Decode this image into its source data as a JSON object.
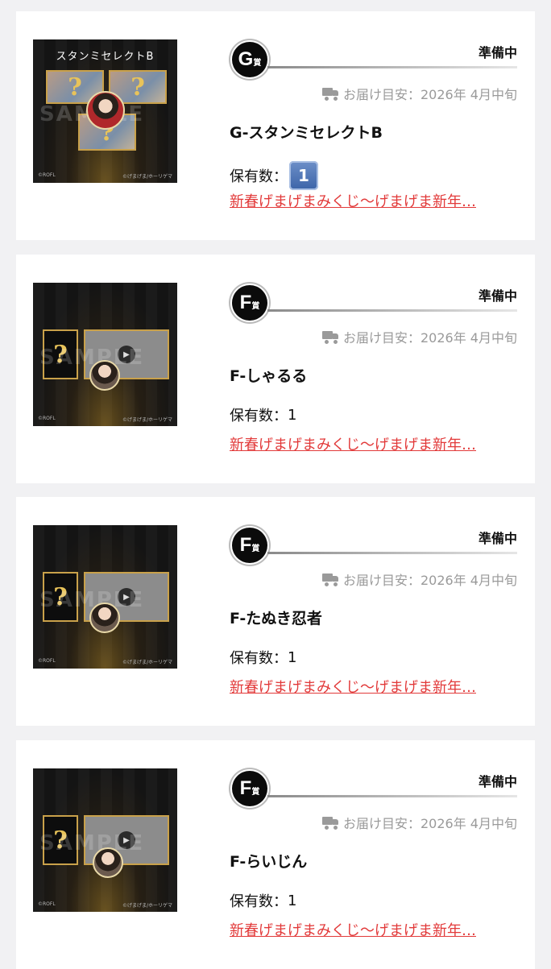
{
  "items": [
    {
      "thumb_title": "スタンミセレクトB",
      "thumb_variant": "g",
      "grade_letter": "G",
      "grade_suffix": "賞",
      "status": "準備中",
      "delivery": "お届け目安：2026年 4月中旬",
      "name": "G-スタンミセレクトB",
      "count_label": "保有数：",
      "count": "1",
      "count_style": "keycap-emoji",
      "lottery_link": "新春げまげまみくじ〜げまげま新年…"
    },
    {
      "thumb_title": "",
      "thumb_variant": "f",
      "grade_letter": "F",
      "grade_suffix": "賞",
      "status": "準備中",
      "delivery": "お届け目安：2026年 4月中旬",
      "name": "F-しゃるる",
      "count_label": "保有数：",
      "count": "1",
      "count_style": "plain",
      "lottery_link": "新春げまげまみくじ〜げまげま新年…"
    },
    {
      "thumb_title": "",
      "thumb_variant": "f",
      "grade_letter": "F",
      "grade_suffix": "賞",
      "status": "準備中",
      "delivery": "お届け目安：2026年 4月中旬",
      "name": "F-たぬき忍者",
      "count_label": "保有数：",
      "count": "1",
      "count_style": "plain",
      "lottery_link": "新春げまげまみくじ〜げまげま新年…"
    },
    {
      "thumb_title": "",
      "thumb_variant": "f",
      "grade_letter": "F",
      "grade_suffix": "賞",
      "status": "準備中",
      "delivery": "お届け目安：2026年 4月中旬",
      "name": "F-らいじん",
      "count_label": "保有数：",
      "count": "1",
      "count_style": "plain",
      "lottery_link": "新春げまげまみくじ〜げまげま新年…"
    }
  ],
  "thumb_common": {
    "watermark": "SAMPLE",
    "copyright_left": "©ROFL",
    "copyright_right": "©げまげま/ホーリゲマ",
    "question_mark": "?",
    "play_symbol": "▶"
  },
  "colors": {
    "link": "#e23a3a",
    "badge": "#0b0b0b",
    "muted": "#9a9a9a",
    "thumb_frame": "#c9a14a"
  },
  "icons": {
    "delivery": "truck-icon",
    "play": "play-icon"
  }
}
